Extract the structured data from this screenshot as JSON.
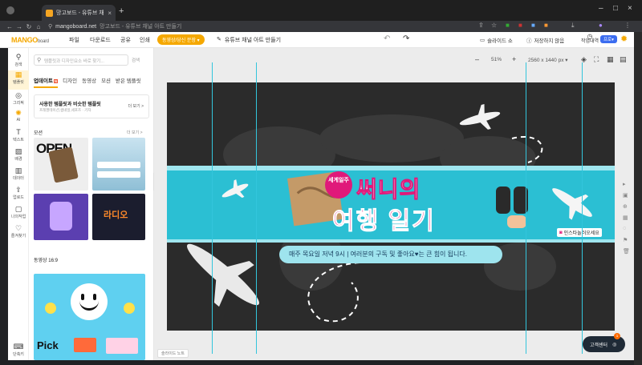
{
  "browser": {
    "tab_title": "망고보드 - 유튜브 채널 아트 만",
    "tab_close": "×",
    "new_tab": "+",
    "url_site": "mangoboard.net",
    "url_rest": "망고보드 - 유튜브 채널 아트 만들기",
    "window_controls": [
      "–",
      "□",
      "×"
    ]
  },
  "app": {
    "logo": "MANGO",
    "logo_suffix": "board",
    "menu": [
      "파일",
      "다운로드",
      "공유",
      "인쇄"
    ],
    "pill": "동영상/당신 문장 ▾",
    "doc_title": "유튜브 채널 아트 만들기",
    "slideshow": "슬라이드 쇼",
    "save_status": "저장하지 않음",
    "person_label": "작업내역",
    "pro_badge": "프로▾"
  },
  "rail": [
    {
      "label": "검색",
      "icon": "search-icon"
    },
    {
      "label": "템플릿",
      "icon": "template-icon",
      "active": true
    },
    {
      "label": "그리픽",
      "icon": "graphic-icon"
    },
    {
      "label": "AI",
      "icon": "ai-icon"
    },
    {
      "label": "텍스트",
      "icon": "text-icon"
    },
    {
      "label": "배경",
      "icon": "background-icon"
    },
    {
      "label": "데이터",
      "icon": "data-icon"
    },
    {
      "label": "업로드",
      "icon": "upload-icon"
    },
    {
      "label": "나의작업",
      "icon": "my-work-icon"
    },
    {
      "label": "즐겨찾기",
      "icon": "favorite-icon"
    },
    {
      "label": "단축키",
      "icon": "keyboard-icon"
    }
  ],
  "panel": {
    "search_placeholder": "템플릿과 디자인요소 바로 찾기...",
    "search_button": "검색",
    "tabs": [
      "업데이트",
      "디자인",
      "동영상",
      "모션",
      "받은 템플릿"
    ],
    "update_badge": "N",
    "promo_title": "사용한 템플릿과 비슷한 템플릿",
    "promo_sub": "프레젠테이션,썸네일,세포즈 · 기자",
    "promo_more": "더 보기 >",
    "section_motion": "모션",
    "section_video": "동영상 16:9",
    "more": "더 보기 >",
    "thumb_open": "OPEN",
    "thumb_radio": "라디오",
    "thumb_pick": "Pick"
  },
  "toolbar": {
    "zoom": "51%",
    "minus": "–",
    "plus": "+",
    "size": "2560 x 1440 px ▾"
  },
  "banner": {
    "badge": "세계일주",
    "title_line1": "써니의",
    "title_line2": "여행 일기",
    "instagram": "인스타놀러오세요",
    "subtitle": "매주 목요일 저녁 9시 | 여러분의 구독 및 좋아요♥는 큰 힘이 됩니다."
  },
  "bottom": {
    "memo": "슬라이드 노트",
    "help": "고객센터",
    "help_count": "1"
  },
  "colors": {
    "brand": "#f5a800",
    "banner_teal": "#2bbfd3",
    "banner_pink": "#e0197a"
  }
}
